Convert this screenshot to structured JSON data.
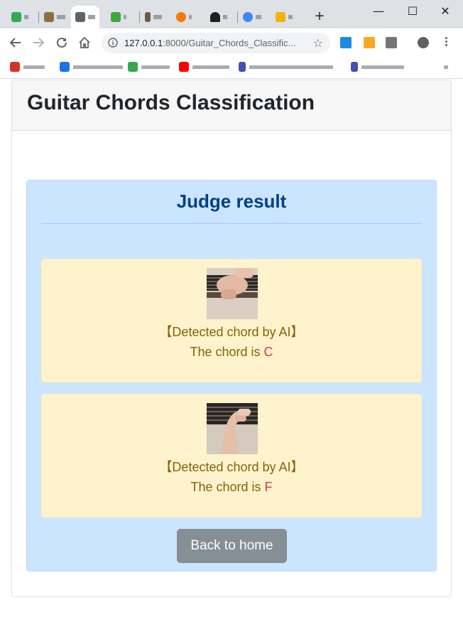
{
  "browser": {
    "url_host": "127.0.0.1",
    "url_rest": ":8000/Guitar_Chords_Classific...",
    "icons": {
      "back": "back-arrow-icon",
      "forward": "forward-arrow-icon",
      "reload": "reload-icon",
      "home": "home-icon",
      "info": "info-icon",
      "star": "star-icon",
      "new_tab": "plus-icon",
      "minimize": "minimize-icon",
      "maximize": "maximize-icon",
      "close": "close-icon",
      "menu": "kebab-menu-icon"
    },
    "glyphs": {
      "new_tab": "+",
      "minimize": "—",
      "maximize": "☐",
      "close": "✕",
      "star": "☆"
    }
  },
  "page": {
    "title": "Guitar Chords Classification",
    "result_heading": "Judge result",
    "results": [
      {
        "label": "【Detected chord by AI】",
        "prefix": "The chord is ",
        "chord": "C",
        "image": "guitar-hand-photo"
      },
      {
        "label": "【Detected chord by AI】",
        "prefix": "The chord is ",
        "chord": "F",
        "image": "guitar-hand-photo"
      }
    ],
    "back_button": "Back to home"
  },
  "colors": {
    "alert_bg": "#cce5ff",
    "heading": "#004085",
    "result_bg": "#fff3cd",
    "result_text": "#856404",
    "chord": "#dc3545",
    "button_bg": "#868e96"
  }
}
